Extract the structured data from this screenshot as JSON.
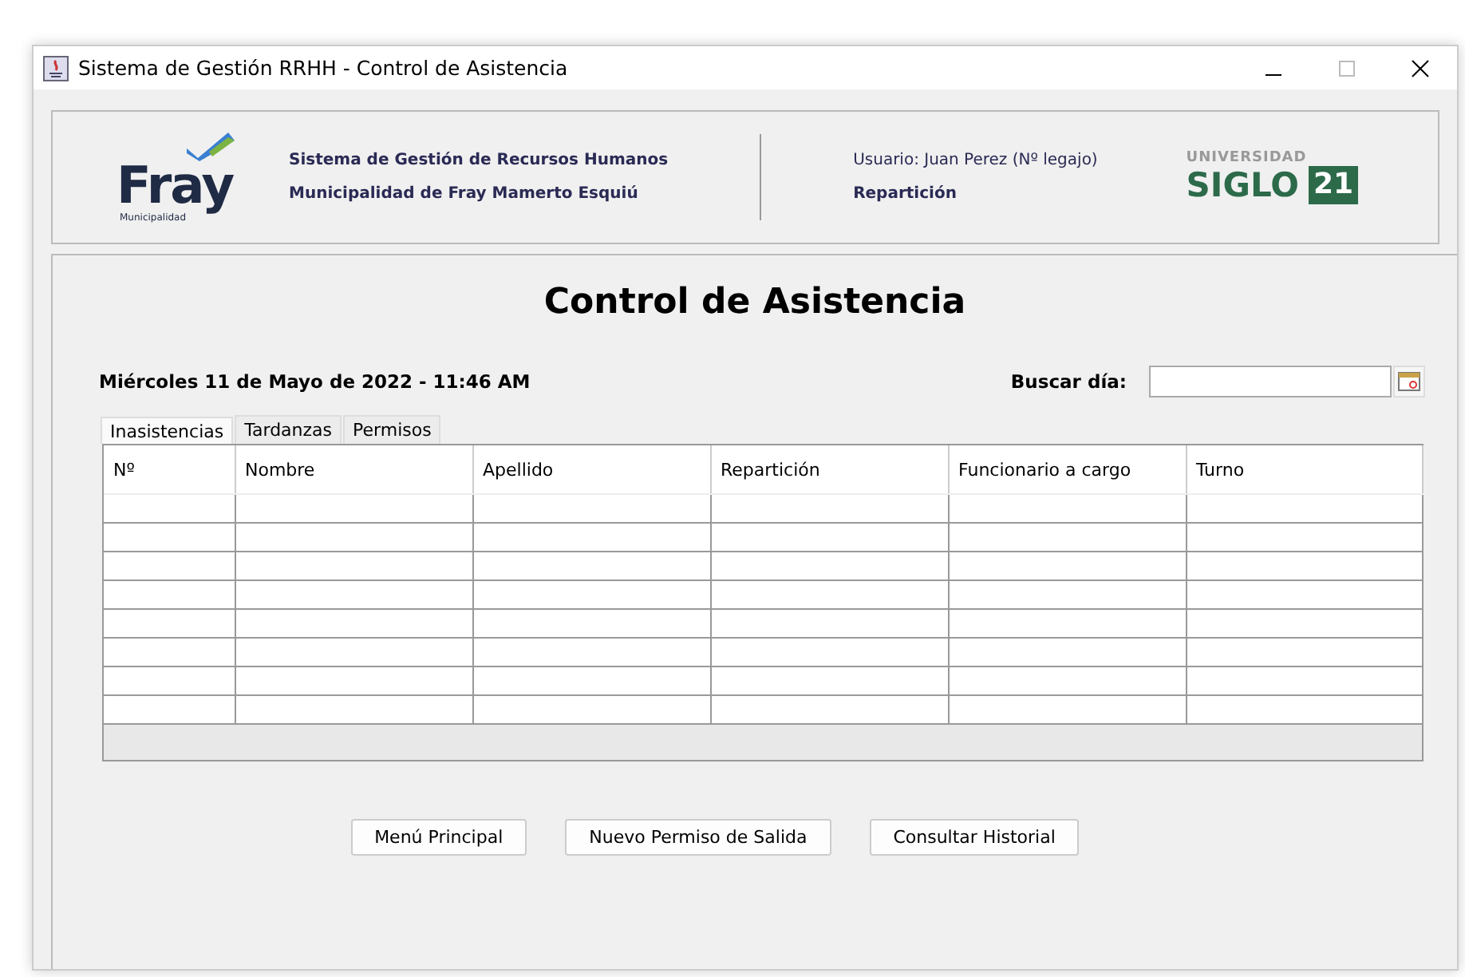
{
  "window": {
    "title": "Sistema de Gestión RRHH - Control de Asistencia"
  },
  "header": {
    "left_logo": {
      "name": "Fray",
      "subtitle": "Municipalidad"
    },
    "system_lines": [
      "Sistema de Gestión de Recursos Humanos",
      "Municipalidad de Fray Mamerto Esquiú"
    ],
    "user": "Usuario: Juan Perez (Nº legajo)",
    "department": "Repartición",
    "right_logo": {
      "top": "UNIVERSIDAD",
      "word": "SIGLO",
      "number": "21"
    }
  },
  "title": "Control de Asistencia",
  "date": "Miércoles 11 de Mayo de 2022 - 11:46 AM",
  "search": {
    "label": "Buscar día:"
  },
  "tabs": [
    {
      "label": "Inasistencias",
      "selected": true
    },
    {
      "label": "Tardanzas",
      "selected": false
    },
    {
      "label": "Permisos",
      "selected": false
    }
  ],
  "table": {
    "columns": [
      "Nº",
      "Nombre",
      "Apellido",
      "Repartición",
      "Funcionario a cargo",
      "Turno"
    ]
  },
  "buttons": [
    "Menú Principal",
    "Nuevo Permiso de Salida",
    "Consultar Historial"
  ]
}
